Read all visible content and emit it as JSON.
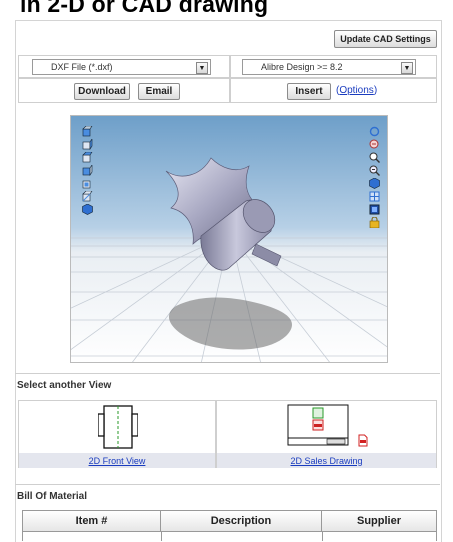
{
  "page": {
    "heading": "in 2-D or CAD drawing"
  },
  "toolbar": {
    "update_cad_label": "Update CAD Settings"
  },
  "format": {
    "file_format_value": "DXF File (*.dxf)",
    "cad_target_value": "Alibre Design >= 8.2",
    "download_label": "Download",
    "email_label": "Email",
    "insert_label": "Insert",
    "options_label": "Options",
    "options_open": "(",
    "options_close": ")"
  },
  "viewer": {
    "left_tools": [
      "cube-front-icon",
      "cube-back-icon",
      "cube-left-icon",
      "cube-right-icon",
      "cube-top-icon",
      "cube-bottom-icon",
      "cube-iso-icon"
    ],
    "right_tools": [
      "rotate-icon",
      "zoom-window-icon",
      "zoom-in-icon",
      "zoom-out-icon",
      "shade-icon",
      "fit-icon",
      "pan-icon",
      "lock-icon"
    ]
  },
  "views": {
    "title": "Select another View",
    "items": [
      {
        "label": "2D Front View",
        "icon": "front-view-thumbnail"
      },
      {
        "label": "2D Sales Drawing",
        "icon": "sales-drawing-thumbnail"
      }
    ]
  },
  "bom": {
    "title": "Bill Of Material",
    "columns": [
      "Item #",
      "Description",
      "Supplier"
    ]
  },
  "colors": {
    "link": "#1a3cbf",
    "caption_bar": "#e4e6ee",
    "pdf_red": "#d22020"
  }
}
